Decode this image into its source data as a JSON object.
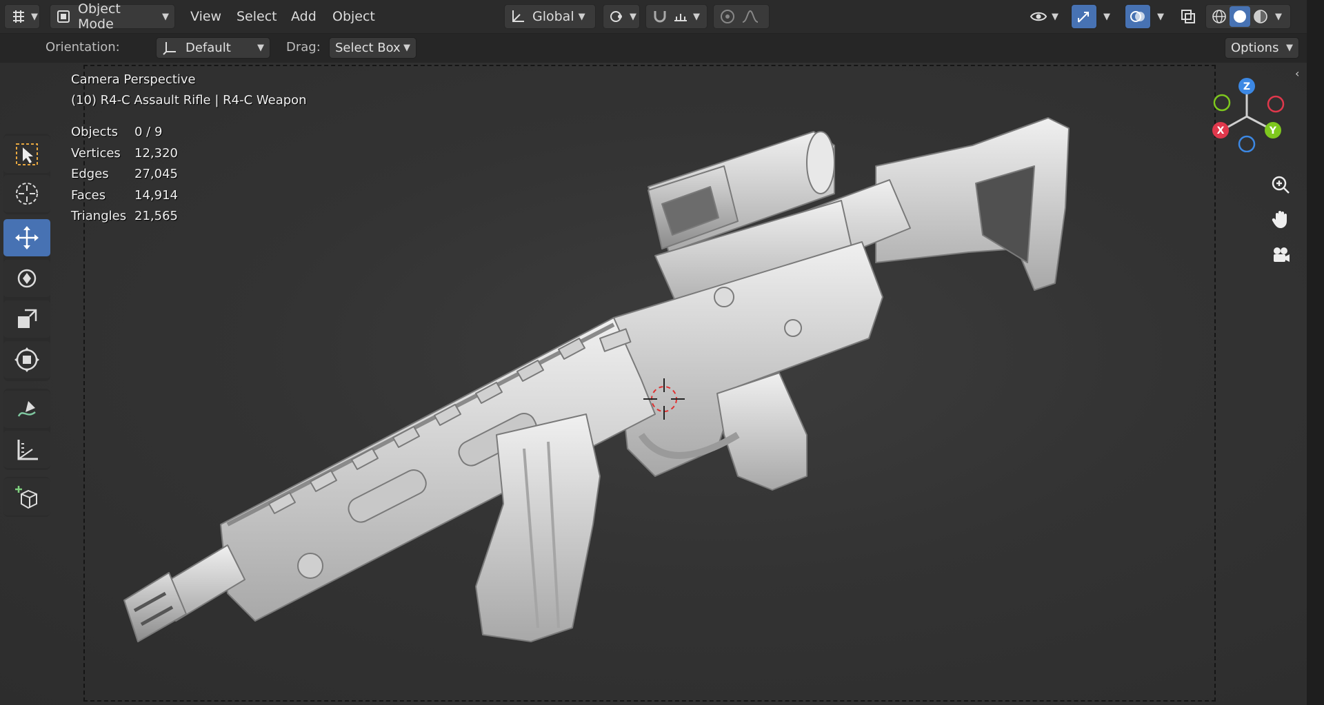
{
  "header": {
    "mode_label": "Object Mode",
    "menus": [
      "View",
      "Select",
      "Add",
      "Object"
    ],
    "transform_orientation": "Global"
  },
  "tool_settings": {
    "orientation_label": "Orientation:",
    "orientation_value": "Default",
    "drag_label": "Drag:",
    "drag_value": "Select Box",
    "options_label": "Options"
  },
  "viewport": {
    "view_name": "Camera Perspective",
    "object_name": "(10) R4-C Assault Rifle | R4-C Weapon",
    "stats": [
      {
        "key": "Objects",
        "value": "0 / 9"
      },
      {
        "key": "Vertices",
        "value": "12,320"
      },
      {
        "key": "Edges",
        "value": "27,045"
      },
      {
        "key": "Faces",
        "value": "14,914"
      },
      {
        "key": "Triangles",
        "value": "21,565"
      }
    ]
  },
  "gizmo": {
    "x": "X",
    "y": "Y",
    "z": "Z"
  },
  "colors": {
    "accent": "#4772b3",
    "x_axis": "#e0384c",
    "y_axis": "#7ec81e",
    "z_axis": "#3c88e4"
  },
  "tools": [
    "select-box-icon",
    "cursor-icon",
    "move-icon",
    "rotate-icon",
    "scale-icon",
    "transform-icon",
    "annotate-icon",
    "measure-icon",
    "add-cube-icon"
  ]
}
